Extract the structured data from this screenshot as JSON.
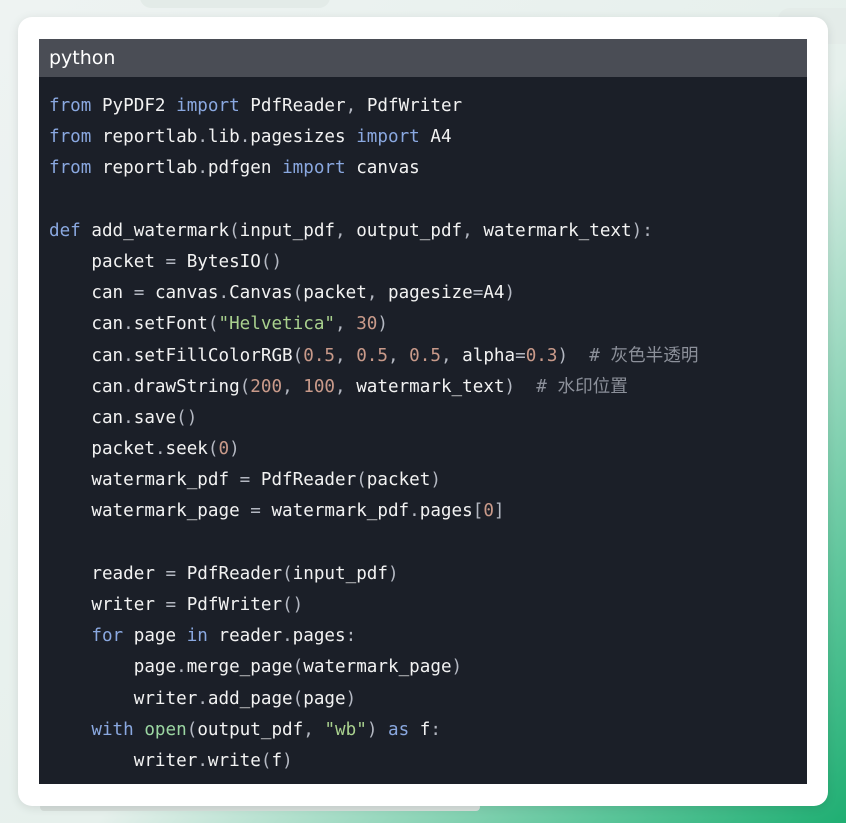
{
  "code_block": {
    "language_label": "python",
    "lines": [
      [
        [
          "kw",
          "from"
        ],
        [
          "p",
          " "
        ],
        [
          "id",
          "PyPDF2"
        ],
        [
          "p",
          " "
        ],
        [
          "kw",
          "import"
        ],
        [
          "p",
          " "
        ],
        [
          "id",
          "PdfReader"
        ],
        [
          "p",
          ", "
        ],
        [
          "id",
          "PdfWriter"
        ]
      ],
      [
        [
          "kw",
          "from"
        ],
        [
          "p",
          " "
        ],
        [
          "id",
          "reportlab"
        ],
        [
          "p",
          "."
        ],
        [
          "id",
          "lib"
        ],
        [
          "p",
          "."
        ],
        [
          "id",
          "pagesizes"
        ],
        [
          "p",
          " "
        ],
        [
          "kw",
          "import"
        ],
        [
          "p",
          " "
        ],
        [
          "id",
          "A4"
        ]
      ],
      [
        [
          "kw",
          "from"
        ],
        [
          "p",
          " "
        ],
        [
          "id",
          "reportlab"
        ],
        [
          "p",
          "."
        ],
        [
          "id",
          "pdfgen"
        ],
        [
          "p",
          " "
        ],
        [
          "kw",
          "import"
        ],
        [
          "p",
          " "
        ],
        [
          "id",
          "canvas"
        ]
      ],
      [],
      [
        [
          "kw",
          "def"
        ],
        [
          "p",
          " "
        ],
        [
          "id",
          "add_watermark"
        ],
        [
          "p",
          "("
        ],
        [
          "id",
          "input_pdf"
        ],
        [
          "p",
          ", "
        ],
        [
          "id",
          "output_pdf"
        ],
        [
          "p",
          ", "
        ],
        [
          "id",
          "watermark_text"
        ],
        [
          "p",
          "):"
        ]
      ],
      [
        [
          "p",
          "    "
        ],
        [
          "id",
          "packet"
        ],
        [
          "p",
          " = "
        ],
        [
          "id",
          "BytesIO"
        ],
        [
          "p",
          "()"
        ]
      ],
      [
        [
          "p",
          "    "
        ],
        [
          "id",
          "can"
        ],
        [
          "p",
          " = "
        ],
        [
          "id",
          "canvas"
        ],
        [
          "p",
          "."
        ],
        [
          "id",
          "Canvas"
        ],
        [
          "p",
          "("
        ],
        [
          "id",
          "packet"
        ],
        [
          "p",
          ", "
        ],
        [
          "id",
          "pagesize"
        ],
        [
          "p",
          "="
        ],
        [
          "id",
          "A4"
        ],
        [
          "p",
          ")"
        ]
      ],
      [
        [
          "p",
          "    "
        ],
        [
          "id",
          "can"
        ],
        [
          "p",
          "."
        ],
        [
          "id",
          "setFont"
        ],
        [
          "p",
          "("
        ],
        [
          "s",
          "\"Helvetica\""
        ],
        [
          "p",
          ", "
        ],
        [
          "n",
          "30"
        ],
        [
          "p",
          ")"
        ]
      ],
      [
        [
          "p",
          "    "
        ],
        [
          "id",
          "can"
        ],
        [
          "p",
          "."
        ],
        [
          "id",
          "setFillColorRGB"
        ],
        [
          "p",
          "("
        ],
        [
          "n",
          "0.5"
        ],
        [
          "p",
          ", "
        ],
        [
          "n",
          "0.5"
        ],
        [
          "p",
          ", "
        ],
        [
          "n",
          "0.5"
        ],
        [
          "p",
          ", "
        ],
        [
          "id",
          "alpha"
        ],
        [
          "p",
          "="
        ],
        [
          "n",
          "0.3"
        ],
        [
          "p",
          ")  "
        ],
        [
          "c",
          "# 灰色半透明"
        ]
      ],
      [
        [
          "p",
          "    "
        ],
        [
          "id",
          "can"
        ],
        [
          "p",
          "."
        ],
        [
          "id",
          "drawString"
        ],
        [
          "p",
          "("
        ],
        [
          "n",
          "200"
        ],
        [
          "p",
          ", "
        ],
        [
          "n",
          "100"
        ],
        [
          "p",
          ", "
        ],
        [
          "id",
          "watermark_text"
        ],
        [
          "p",
          ")  "
        ],
        [
          "c",
          "# 水印位置"
        ]
      ],
      [
        [
          "p",
          "    "
        ],
        [
          "id",
          "can"
        ],
        [
          "p",
          "."
        ],
        [
          "id",
          "save"
        ],
        [
          "p",
          "()"
        ]
      ],
      [
        [
          "p",
          "    "
        ],
        [
          "id",
          "packet"
        ],
        [
          "p",
          "."
        ],
        [
          "id",
          "seek"
        ],
        [
          "p",
          "("
        ],
        [
          "n",
          "0"
        ],
        [
          "p",
          ")"
        ]
      ],
      [
        [
          "p",
          "    "
        ],
        [
          "id",
          "watermark_pdf"
        ],
        [
          "p",
          " = "
        ],
        [
          "id",
          "PdfReader"
        ],
        [
          "p",
          "("
        ],
        [
          "id",
          "packet"
        ],
        [
          "p",
          ")"
        ]
      ],
      [
        [
          "p",
          "    "
        ],
        [
          "id",
          "watermark_page"
        ],
        [
          "p",
          " = "
        ],
        [
          "id",
          "watermark_pdf"
        ],
        [
          "p",
          "."
        ],
        [
          "id",
          "pages"
        ],
        [
          "p",
          "["
        ],
        [
          "n",
          "0"
        ],
        [
          "p",
          "]"
        ]
      ],
      [],
      [
        [
          "p",
          "    "
        ],
        [
          "id",
          "reader"
        ],
        [
          "p",
          " = "
        ],
        [
          "id",
          "PdfReader"
        ],
        [
          "p",
          "("
        ],
        [
          "id",
          "input_pdf"
        ],
        [
          "p",
          ")"
        ]
      ],
      [
        [
          "p",
          "    "
        ],
        [
          "id",
          "writer"
        ],
        [
          "p",
          " = "
        ],
        [
          "id",
          "PdfWriter"
        ],
        [
          "p",
          "()"
        ]
      ],
      [
        [
          "p",
          "    "
        ],
        [
          "kw",
          "for"
        ],
        [
          "p",
          " "
        ],
        [
          "id",
          "page"
        ],
        [
          "p",
          " "
        ],
        [
          "kw",
          "in"
        ],
        [
          "p",
          " "
        ],
        [
          "id",
          "reader"
        ],
        [
          "p",
          "."
        ],
        [
          "id",
          "pages"
        ],
        [
          "p",
          ":"
        ]
      ],
      [
        [
          "p",
          "        "
        ],
        [
          "id",
          "page"
        ],
        [
          "p",
          "."
        ],
        [
          "id",
          "merge_page"
        ],
        [
          "p",
          "("
        ],
        [
          "id",
          "watermark_page"
        ],
        [
          "p",
          ")"
        ]
      ],
      [
        [
          "p",
          "        "
        ],
        [
          "id",
          "writer"
        ],
        [
          "p",
          "."
        ],
        [
          "id",
          "add_page"
        ],
        [
          "p",
          "("
        ],
        [
          "id",
          "page"
        ],
        [
          "p",
          ")"
        ]
      ],
      [
        [
          "p",
          "    "
        ],
        [
          "kw",
          "with"
        ],
        [
          "p",
          " "
        ],
        [
          "b",
          "open"
        ],
        [
          "p",
          "("
        ],
        [
          "id",
          "output_pdf"
        ],
        [
          "p",
          ", "
        ],
        [
          "s",
          "\"wb\""
        ],
        [
          "p",
          ") "
        ],
        [
          "kw",
          "as"
        ],
        [
          "p",
          " "
        ],
        [
          "id",
          "f"
        ],
        [
          "p",
          ":"
        ]
      ],
      [
        [
          "p",
          "        "
        ],
        [
          "id",
          "writer"
        ],
        [
          "p",
          "."
        ],
        [
          "id",
          "write"
        ],
        [
          "p",
          "("
        ],
        [
          "id",
          "f"
        ],
        [
          "p",
          ")"
        ]
      ]
    ]
  },
  "colors": {
    "code_background": "#1b1f28",
    "header_background": "#4a4d55",
    "keyword": "#8aa8e0",
    "identifier": "#f2f2f2",
    "punctuation": "#b4b8c2",
    "string": "#a9d18e",
    "number": "#c99a8a",
    "comment": "#8c909a",
    "builtin": "#9cd7a3"
  }
}
